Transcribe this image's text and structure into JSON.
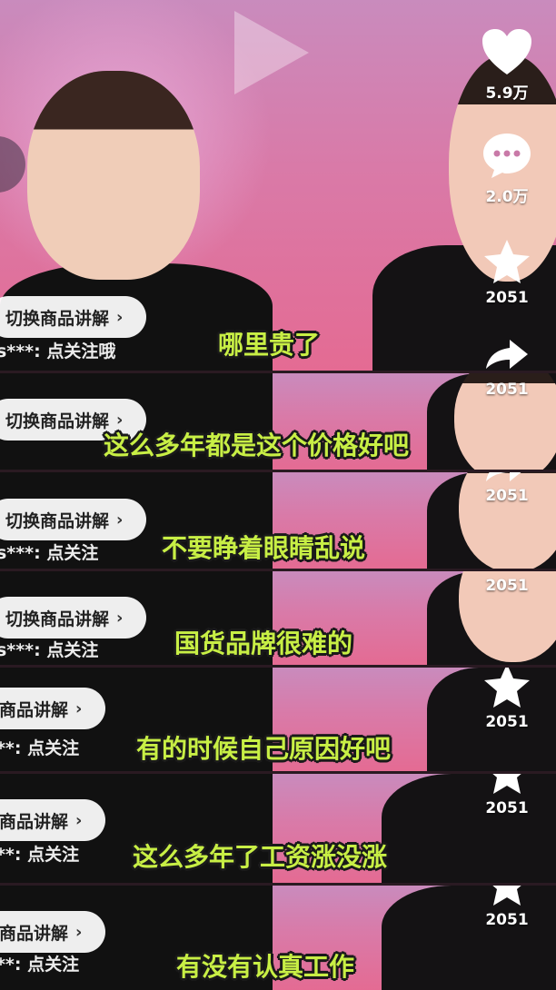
{
  "sidebar": {
    "like_count": "5.9万",
    "comment_count": "2.0万",
    "star_count": "2051",
    "share_counts": [
      "2051",
      "2051",
      "2051",
      "2051",
      "2051",
      "2051"
    ]
  },
  "overlay": {
    "product_button_full": "切换商品讲解",
    "product_button_cut": "换商品讲解",
    "chevron": "›",
    "comment_line_1": "s***: 点关注哦",
    "comment_line_2": "s***: 点关注",
    "comment_line_3": "**: 点关注",
    "comment_line_4": "**: 点关注"
  },
  "subtitles": [
    "哪里贵了",
    "这么多年都是这个价格好吧",
    "不要睁着眼睛乱说",
    "国货品牌很难的",
    "有的时候自己原因好吧",
    "这么多年了工资涨没涨",
    "有没有认真工作"
  ],
  "colors": {
    "subtitle_fill": "#c8ef45",
    "subtitle_outline": "#1a1a1a",
    "pill_bg": "#ffffff",
    "bg_pink": "#d97aa8"
  }
}
